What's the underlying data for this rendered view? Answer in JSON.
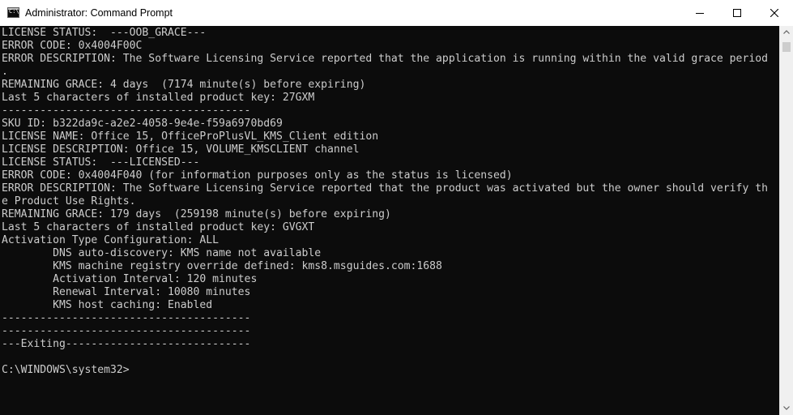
{
  "window": {
    "title": "Administrator: Command Prompt",
    "icon_glyph": "C:\\",
    "icon": "cmd-icon"
  },
  "controls": {
    "minimize_icon": "minimize-icon",
    "maximize_icon": "maximize-icon",
    "close_icon": "close-icon"
  },
  "console": {
    "lines": [
      "LICENSE STATUS:  ---OOB_GRACE---",
      "ERROR CODE: 0x4004F00C",
      "ERROR DESCRIPTION: The Software Licensing Service reported that the application is running within the valid grace period",
      ".",
      "REMAINING GRACE: 4 days  (7174 minute(s) before expiring)",
      "Last 5 characters of installed product key: 27GXM",
      "---------------------------------------",
      "SKU ID: b322da9c-a2e2-4058-9e4e-f59a6970bd69",
      "LICENSE NAME: Office 15, OfficeProPlusVL_KMS_Client edition",
      "LICENSE DESCRIPTION: Office 15, VOLUME_KMSCLIENT channel",
      "LICENSE STATUS:  ---LICENSED---",
      "ERROR CODE: 0x4004F040 (for information purposes only as the status is licensed)",
      "ERROR DESCRIPTION: The Software Licensing Service reported that the product was activated but the owner should verify th",
      "e Product Use Rights.",
      "REMAINING GRACE: 179 days  (259198 minute(s) before expiring)",
      "Last 5 characters of installed product key: GVGXT",
      "Activation Type Configuration: ALL",
      "        DNS auto-discovery: KMS name not available",
      "        KMS machine registry override defined: kms8.msguides.com:1688",
      "        Activation Interval: 120 minutes",
      "        Renewal Interval: 10080 minutes",
      "        KMS host caching: Enabled",
      "---------------------------------------",
      "---------------------------------------",
      "---Exiting-----------------------------",
      "",
      "C:\\WINDOWS\\system32>"
    ]
  },
  "colors": {
    "console_bg": "#0c0c0c",
    "console_fg": "#cccccc",
    "titlebar_bg": "#ffffff"
  }
}
